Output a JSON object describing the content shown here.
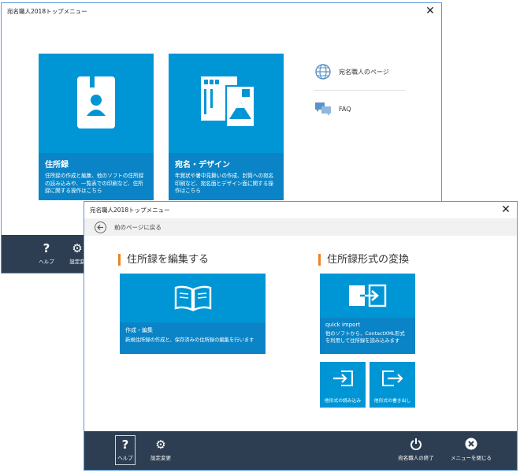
{
  "window1": {
    "title": "宛名職人2018トップメニュー",
    "close_glyph": "✕",
    "tile_address": {
      "title": "住所録",
      "description": "住所録の作成と編集、他のソフトの住所録の読み込みや、一覧表での印刷など、住所録に関する操作はこちら"
    },
    "tile_design": {
      "title": "宛名・デザイン",
      "description": "年賀状や暑中見舞いの作成、封筒への宛名印刷など、宛名面とデザイン面に関する操作はこちら"
    },
    "side_links": {
      "page": "宛名職人のページ",
      "faq": "FAQ"
    },
    "footer": {
      "help_label": "ヘルプ",
      "settings_label": "設定変"
    }
  },
  "window2": {
    "title": "宛名職人2018トップメニュー",
    "close_glyph": "✕",
    "back_label": "前のページに戻る",
    "section_edit": "住所録を編集する",
    "section_convert": "住所録形式の変換",
    "tile_create": {
      "title": "作成・編集",
      "description": "新規住所録の作成と、保存済みの住所録の編集を行います"
    },
    "tile_quick": {
      "title": "quick import",
      "description": "他のソフトから、ContactXML形式を利用して住所録を読み込みます"
    },
    "tile_import": {
      "label": "他形式の読み込み"
    },
    "tile_export": {
      "label": "他形式の書き出し"
    },
    "footer": {
      "help_label": "ヘルプ",
      "settings_label": "設定変更",
      "quit_label": "宛名職人の終了",
      "close_menu_label": "メニューを閉じる"
    }
  },
  "colors": {
    "tile_blue": "#0096d6",
    "tile_caption_blue": "#0a84c6",
    "footer_navy": "#2e3e52",
    "accent_orange": "#f08123",
    "window_border": "#5b9bd5"
  },
  "icons": [
    "address-book-icon",
    "postcard-icon",
    "globe-icon",
    "chat-icon",
    "back-arrow-icon",
    "open-book-icon",
    "import-arrow-icon",
    "export-arrow-icon",
    "help-icon",
    "gear-icon",
    "power-icon",
    "close-circle-icon"
  ]
}
